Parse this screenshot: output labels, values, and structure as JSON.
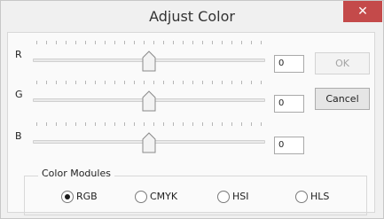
{
  "window": {
    "title": "Adjust Color",
    "close_glyph": "✕"
  },
  "sliders": [
    {
      "label": "R",
      "value": "0",
      "position": 0.5
    },
    {
      "label": "G",
      "value": "0",
      "position": 0.5
    },
    {
      "label": "B",
      "value": "0",
      "position": 0.5
    }
  ],
  "buttons": {
    "ok_label": "OK",
    "cancel_label": "Cancel"
  },
  "color_modules": {
    "title": "Color Modules",
    "options": [
      {
        "label": "RGB",
        "checked": true
      },
      {
        "label": "CMYK",
        "checked": false
      },
      {
        "label": "HSI",
        "checked": false
      },
      {
        "label": "HLS",
        "checked": false
      }
    ]
  },
  "colors": {
    "close_button": "#c44a4a",
    "window_bg": "#f0f0f0"
  }
}
